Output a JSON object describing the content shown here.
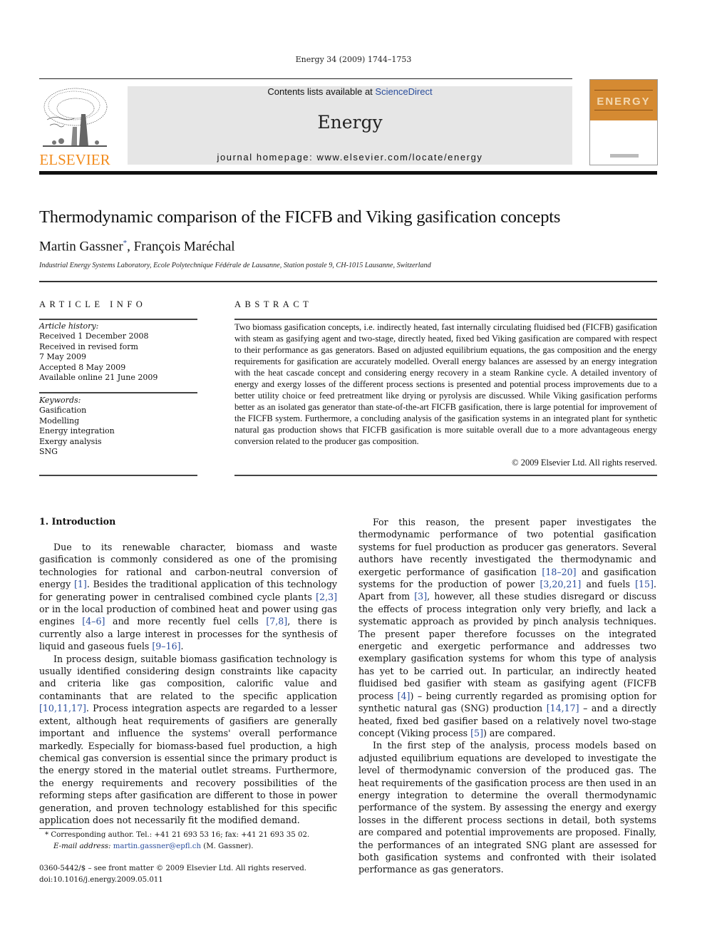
{
  "header": {
    "running_head": "Energy 34 (2009) 1744–1753",
    "publisher_logo_text": "ELSEVIER",
    "contents_prefix": "Contents lists available at ",
    "contents_link": "ScienceDirect",
    "journal_name": "Energy",
    "homepage": "journal homepage: www.elsevier.com/locate/energy",
    "cover_title": "ENERGY",
    "brand_color": "#f28c1e",
    "cover_color": "#d58a32",
    "link_color": "#2a4d9c"
  },
  "article": {
    "title": "Thermodynamic comparison of the FICFB and Viking gasification concepts",
    "author1": "Martin Gassner",
    "author1_mark": "*",
    "author_sep": ", ",
    "author2": "François Maréchal",
    "affiliation": "Industrial Energy Systems Laboratory, Ecole Polytechnique Fédérale de Lausanne, Station postale 9, CH-1015 Lausanne, Switzerland"
  },
  "article_info": {
    "heading": "ARTICLE INFO",
    "history_label": "Article history:",
    "history": [
      "Received 1 December 2008",
      "Received in revised form",
      "7 May 2009",
      "Accepted 8 May 2009",
      "Available online 21 June 2009"
    ],
    "keywords_label": "Keywords:",
    "keywords": [
      "Gasification",
      "Modelling",
      "Energy integration",
      "Exergy analysis",
      "SNG"
    ]
  },
  "abstract": {
    "heading": "ABSTRACT",
    "text": "Two biomass gasification concepts, i.e. indirectly heated, fast internally circulating fluidised bed (FICFB) gasification with steam as gasifying agent and two-stage, directly heated, fixed bed Viking gasification are compared with respect to their performance as gas generators. Based on adjusted equilibrium equations, the gas composition and the energy requirements for gasification are accurately modelled. Overall energy balances are assessed by an energy integration with the heat cascade concept and considering energy recovery in a steam Rankine cycle. A detailed inventory of energy and exergy losses of the different process sections is presented and potential process improvements due to a better utility choice or feed pretreatment like drying or pyrolysis are discussed. While Viking gasification performs better as an isolated gas generator than state-of-the-art FICFB gasification, there is large potential for improvement of the FICFB system. Furthermore, a concluding analysis of the gasification systems in an integrated plant for synthetic natural gas production shows that FICFB gasification is more suitable overall due to a more advantageous energy conversion related to the producer gas composition.",
    "copyright": "© 2009 Elsevier Ltd. All rights reserved."
  },
  "introduction": {
    "heading": "1.  Introduction",
    "p1": [
      {
        "t": "Due to its renewable character, biomass and waste gasification is commonly considered as one of the promising technologies for rational and carbon-neutral conversion of energy "
      },
      {
        "r": "[1]"
      },
      {
        "t": ". Besides the traditional application of this technology for generating power in centralised combined cycle plants "
      },
      {
        "r": "[2,3]"
      },
      {
        "t": " or in the local production of combined heat and power using gas engines "
      },
      {
        "r": "[4–6]"
      },
      {
        "t": " and more recently fuel cells "
      },
      {
        "r": "[7,8]"
      },
      {
        "t": ", there is currently also a large interest in processes for the synthesis of liquid and gaseous fuels "
      },
      {
        "r": "[9–16]"
      },
      {
        "t": "."
      }
    ],
    "p2": [
      {
        "t": "In process design, suitable biomass gasification technology is usually identified considering design constraints like capacity and criteria like gas composition, calorific value and contaminants that are related to the specific application "
      },
      {
        "r": "[10,11,17]"
      },
      {
        "t": ". Process integration aspects are regarded to a lesser extent, although heat requirements of gasifiers are generally important and influence the systems' overall performance markedly. Especially for biomass-based fuel production, a high chemical gas conversion is essential since the primary product is the energy stored in the material outlet streams. Furthermore, the energy requirements and recovery possibilities of the reforming steps after gasification are different to those in power generation, and proven technology established for this specific application does not necessarily fit the modified demand."
      }
    ],
    "p3": [
      {
        "t": "For this reason, the present paper investigates the thermodynamic performance of two potential gasification systems for fuel production as producer gas generators. Several authors have recently investigated the thermodynamic and exergetic performance of gasification "
      },
      {
        "r": "[18–20]"
      },
      {
        "t": " and gasification systems for the production of power "
      },
      {
        "r": "[3,20,21]"
      },
      {
        "t": " and fuels "
      },
      {
        "r": "[15]"
      },
      {
        "t": ". Apart from "
      },
      {
        "r": "[3]"
      },
      {
        "t": ", however, all these studies disregard or discuss the effects of process integration only very briefly, and lack a systematic approach as provided by pinch analysis techniques. The present paper therefore focusses on the integrated energetic and exergetic performance and addresses two exemplary gasification systems for whom this type of analysis has yet to be carried out. In particular, an indirectly heated fluidised bed gasifier with steam as gasifying agent (FICFB process "
      },
      {
        "r": "[4]"
      },
      {
        "t": ") – being currently regarded as promising option for synthetic natural gas (SNG) production "
      },
      {
        "r": "[14,17]"
      },
      {
        "t": " – and a directly heated, fixed bed gasifier based on a relatively novel two-stage concept (Viking process "
      },
      {
        "r": "[5]"
      },
      {
        "t": ") are compared."
      }
    ],
    "p4": [
      {
        "t": "In the first step of the analysis, process models based on adjusted equilibrium equations are developed to investigate the level of thermodynamic conversion of the produced gas. The heat requirements of the gasification process are then used in an energy integration to determine the overall thermodynamic performance of the system. By assessing the energy and exergy losses in the different process sections in detail, both systems are compared and potential improvements are proposed. Finally, the performances of an integrated SNG plant are assessed for both gasification systems and confronted with their isolated performance as gas generators."
      }
    ]
  },
  "footnote": {
    "mark": "*",
    "text": " Corresponding author. Tel.: +41 21 693 53 16; fax: +41 21 693 35 02.",
    "email_label": "E-mail address:",
    "email": "martin.gassner@epfl.ch",
    "email_suffix": " (M. Gassner)."
  },
  "front_matter": {
    "issn": "0360-5442/$ – see front matter © 2009 Elsevier Ltd. All rights reserved.",
    "doi": "doi:10.1016/j.energy.2009.05.011"
  }
}
